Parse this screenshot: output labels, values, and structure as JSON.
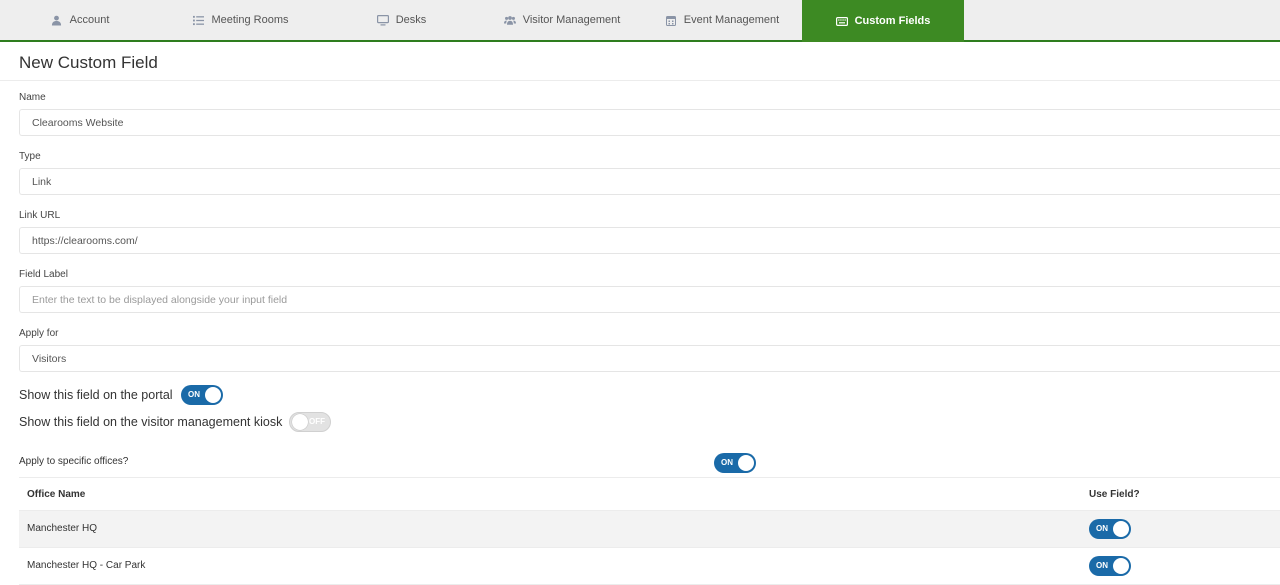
{
  "tabs": [
    {
      "label": "Account",
      "icon": "user-icon",
      "active": false
    },
    {
      "label": "Meeting Rooms",
      "icon": "list-icon",
      "active": false
    },
    {
      "label": "Desks",
      "icon": "monitor-icon",
      "active": false
    },
    {
      "label": "Visitor Management",
      "icon": "users-icon",
      "active": false
    },
    {
      "label": "Event Management",
      "icon": "calendar-icon",
      "active": false
    },
    {
      "label": "Custom Fields",
      "icon": "keyboard-icon",
      "active": true
    }
  ],
  "colors": {
    "active_tab": "#3d8a23",
    "toggle_on": "#1a6aa8",
    "toggle_off": "#e2e2e2"
  },
  "page": {
    "title": "New Custom Field"
  },
  "form": {
    "name": {
      "label": "Name",
      "value": "Clearooms Website"
    },
    "type": {
      "label": "Type",
      "value": "Link"
    },
    "link_url": {
      "label": "Link URL",
      "value": "https://clearooms.com/"
    },
    "field_label": {
      "label": "Field Label",
      "value": "",
      "placeholder": "Enter the text to be displayed alongside your input field"
    },
    "apply_for": {
      "label": "Apply for",
      "value": "Visitors"
    }
  },
  "toggles": {
    "portal": {
      "label": "Show this field on the portal",
      "state": "ON"
    },
    "kiosk": {
      "label": "Show this field on the visitor management kiosk",
      "state": "OFF"
    },
    "specific_offices": {
      "label": "Apply to specific offices?",
      "state": "ON"
    }
  },
  "offices": {
    "headers": {
      "name": "Office Name",
      "use": "Use Field?"
    },
    "rows": [
      {
        "name": "Manchester HQ",
        "use": "ON"
      },
      {
        "name": "Manchester HQ - Car Park",
        "use": "ON"
      }
    ]
  }
}
